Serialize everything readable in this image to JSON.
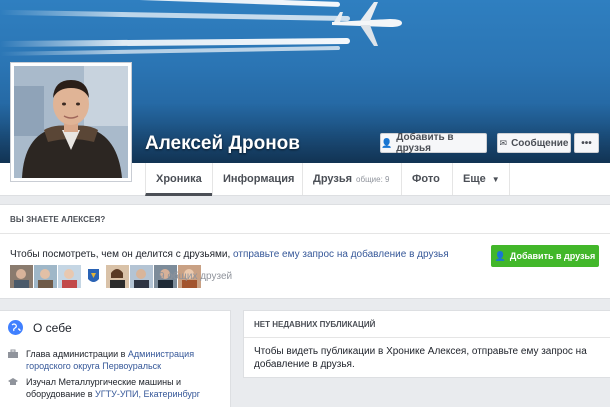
{
  "profile": {
    "name": "Алексей Дронов",
    "add_friend": "Добавить в друзья",
    "message": "Сообщение",
    "more": "•••"
  },
  "tabs": [
    {
      "label": "Хроника"
    },
    {
      "label": "Информация"
    },
    {
      "label": "Друзья",
      "count": "общие: 9"
    },
    {
      "label": "Фото"
    },
    {
      "label": "Еще",
      "caret": "▼"
    }
  ],
  "know": {
    "heading": "ВЫ ЗНАЕТЕ АЛЕКСЕЯ?",
    "text_prefix": "Чтобы посмотреть, чем он делится с друзьями,",
    "text_link": "отправьте ему запрос на добавление в друзья",
    "add_button": "Добавить в друзья",
    "mutual_friends": "9 общих друзей"
  },
  "about": {
    "title": "О себе",
    "job_prefix": "Глава администрации в",
    "job_link": "Администрация городского округа Первоуральск",
    "edu_prefix": "Изучал Металлургические машины и оборудование в",
    "edu_link": "УГТУ-УПИ, Екатеринбург"
  },
  "recent": {
    "heading": "НЕТ НЕДАВНИХ ПУБЛИКАЦИЙ",
    "text": "Чтобы видеть публикации в Хронике Алексея, отправьте ему запрос на добавление в друзья."
  },
  "colors": {
    "accent_blue": "#365899",
    "green": "#42b72a",
    "cover_sky": "#2b75b4"
  }
}
